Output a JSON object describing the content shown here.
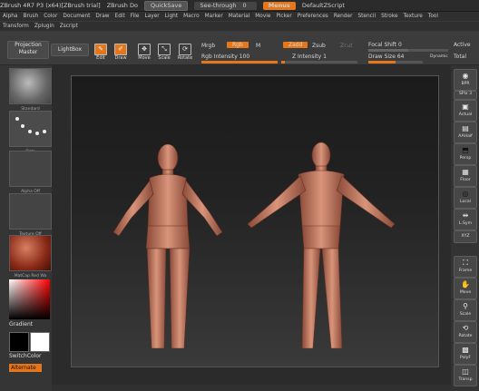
{
  "title": {
    "app": "ZBrush 4R7 P3 (x64)[ZBrush trial]",
    "doc": "ZBrush Do",
    "quicksave": "QuickSave",
    "see_through": "See-through",
    "see_through_value": "0",
    "menus": "Menus",
    "script": "DefaultZScript"
  },
  "menu1": [
    "Alpha",
    "Brush",
    "Color",
    "Document",
    "Draw",
    "Edit",
    "File",
    "Layer",
    "Light",
    "Macro",
    "Marker",
    "Material",
    "Movie",
    "Picker",
    "Preferences",
    "Render",
    "Stencil",
    "Stroke",
    "Texture",
    "Tool"
  ],
  "menu2": [
    "Transform",
    "Zplugin",
    "Zscript"
  ],
  "shelf": {
    "projection_master": "Projection Master",
    "lightbox": "LightBox",
    "edit": "Edit",
    "draw": "Draw",
    "move": "Move",
    "scale": "Scale",
    "rotate": "Rotate",
    "mrgb": "Mrgb",
    "rgb": "Rgb",
    "m": "M",
    "zadd": "Zadd",
    "zsub": "Zsub",
    "zcut": "Zcut",
    "focal_shift": "Focal Shift",
    "focal_shift_value": "0",
    "active": "Active",
    "total": "Total",
    "rgb_intensity": "Rgb Intensity",
    "rgb_intensity_value": "100",
    "z_intensity": "Z Intensity",
    "z_intensity_value": "1",
    "draw_size": "Draw Size",
    "draw_size_value": "64",
    "dynamic": "Dynamic"
  },
  "left": {
    "brush": "Standard",
    "stroke": "Dots",
    "alpha": "Alpha Off",
    "texture": "Texture Off",
    "material": "MatCap Red Wa",
    "gradient": "Gradient",
    "switch_color": "SwitchColor",
    "alternate": "Alternate"
  },
  "right": [
    "BPR",
    "SPix",
    "Actual",
    "AAHalf",
    "Persp",
    "Floor",
    "Local",
    "L.Sym",
    "XYZ",
    "Frame",
    "Move",
    "Scale",
    "Rotate",
    "PolyF",
    "Transp"
  ],
  "right_spix_value": "3",
  "colors": {
    "accent": "#e6761a",
    "skin": "#c9826a"
  }
}
